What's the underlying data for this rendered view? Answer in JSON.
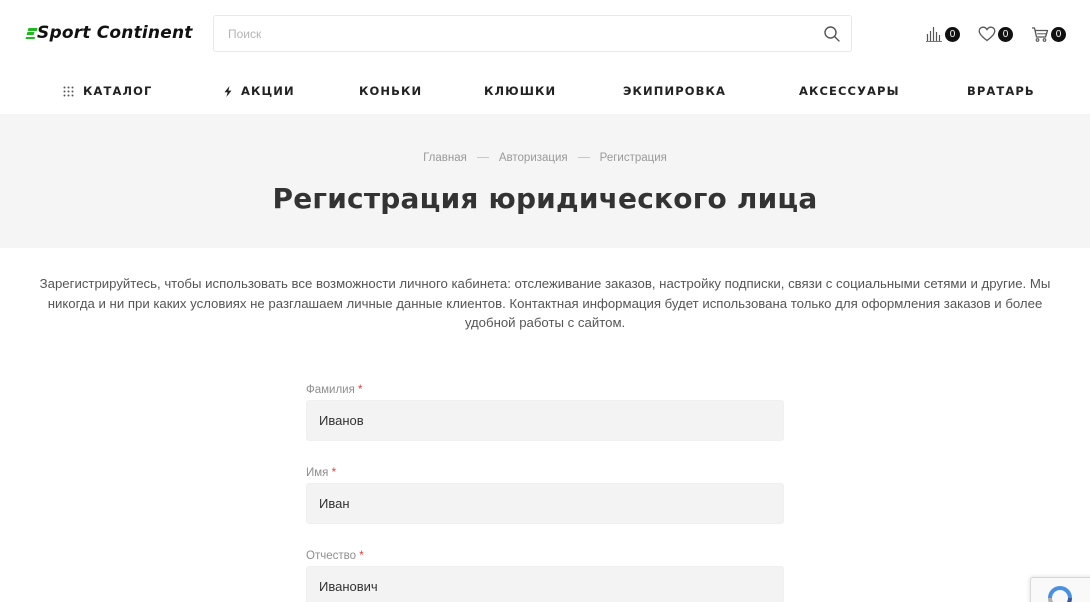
{
  "header": {
    "logo_text": "Sport Continent",
    "search_placeholder": "Поиск",
    "compare_count": "0",
    "favorites_count": "0",
    "cart_count": "0"
  },
  "nav": {
    "items": [
      {
        "label": "КАТАЛОГ",
        "icon": "grid-icon"
      },
      {
        "label": "АКЦИИ",
        "icon": "lightning-icon"
      },
      {
        "label": "КОНЬКИ"
      },
      {
        "label": "КЛЮШКИ"
      },
      {
        "label": "ЭКИПИРОВКА"
      },
      {
        "label": "АКСЕССУАРЫ"
      },
      {
        "label": "ВРАТАРЬ"
      }
    ]
  },
  "breadcrumb": {
    "items": [
      "Главная",
      "Авторизация",
      "Регистрация"
    ]
  },
  "page": {
    "title": "Регистрация юридического лица",
    "intro": "Зарегистрируйтесь, чтобы использовать все возможности личного кабинета: отслеживание заказов, настройку подписки, связи с социальными сетями и другие. Мы никогда и ни при каких условиях не разглашаем личные данные клиентов. Контактная информация будет использована только для оформления заказов и более удобной работы с сайтом."
  },
  "form": {
    "required_mark": "*",
    "fields": [
      {
        "label": "Фамилия",
        "value": "Иванов"
      },
      {
        "label": "Имя",
        "value": "Иван"
      },
      {
        "label": "Отчество",
        "value": "Иванович"
      }
    ]
  },
  "colors": {
    "logo_accent": "#1db91d",
    "required": "#e5393b",
    "band_bg": "#f5f5f5",
    "input_bg": "#f3f3f3"
  }
}
